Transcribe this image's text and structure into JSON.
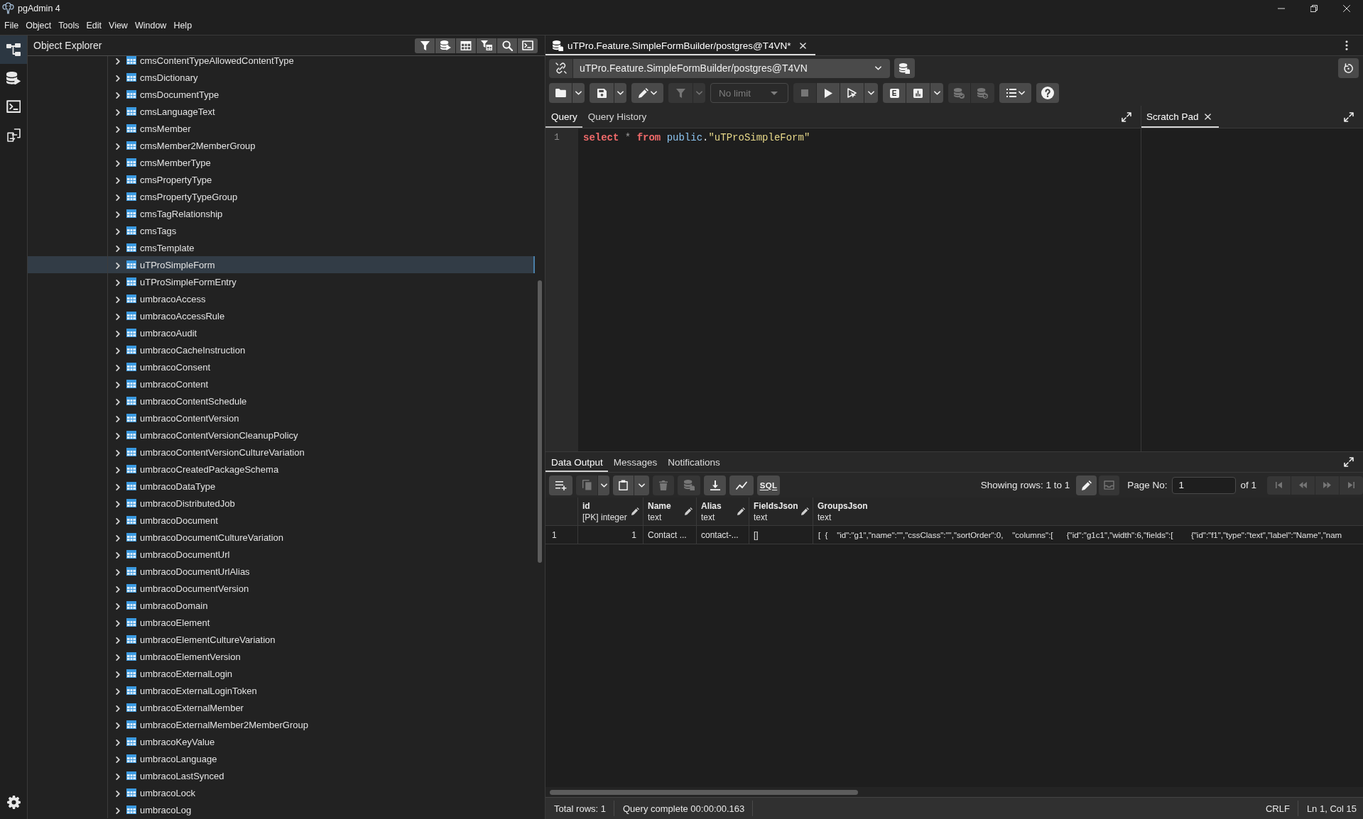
{
  "window": {
    "title": "pgAdmin 4"
  },
  "menu": [
    "File",
    "Object",
    "Tools",
    "Edit",
    "View",
    "Window",
    "Help"
  ],
  "rail": [
    {
      "selected": true
    },
    {
      "selected": false
    },
    {
      "selected": false
    },
    {
      "selected": false
    }
  ],
  "object_explorer": {
    "title": "Object Explorer",
    "tree": [
      {
        "label": "cmsContentTypeAllowedContentType",
        "selected": false,
        "expanded": false
      },
      {
        "label": "cmsDictionary",
        "selected": false,
        "expanded": false
      },
      {
        "label": "cmsDocumentType",
        "selected": false,
        "expanded": false
      },
      {
        "label": "cmsLanguageText",
        "selected": false,
        "expanded": false
      },
      {
        "label": "cmsMember",
        "selected": false,
        "expanded": false
      },
      {
        "label": "cmsMember2MemberGroup",
        "selected": false,
        "expanded": false
      },
      {
        "label": "cmsMemberType",
        "selected": false,
        "expanded": false
      },
      {
        "label": "cmsPropertyType",
        "selected": false,
        "expanded": false
      },
      {
        "label": "cmsPropertyTypeGroup",
        "selected": false,
        "expanded": false
      },
      {
        "label": "cmsTagRelationship",
        "selected": false,
        "expanded": false
      },
      {
        "label": "cmsTags",
        "selected": false,
        "expanded": false
      },
      {
        "label": "cmsTemplate",
        "selected": false,
        "expanded": false
      },
      {
        "label": "uTProSimpleForm",
        "selected": true,
        "expanded": false
      },
      {
        "label": "uTProSimpleFormEntry",
        "selected": false,
        "expanded": false
      },
      {
        "label": "umbracoAccess",
        "selected": false,
        "expanded": false
      },
      {
        "label": "umbracoAccessRule",
        "selected": false,
        "expanded": false
      },
      {
        "label": "umbracoAudit",
        "selected": false,
        "expanded": false
      },
      {
        "label": "umbracoCacheInstruction",
        "selected": false,
        "expanded": false
      },
      {
        "label": "umbracoConsent",
        "selected": false,
        "expanded": false
      },
      {
        "label": "umbracoContent",
        "selected": false,
        "expanded": false
      },
      {
        "label": "umbracoContentSchedule",
        "selected": false,
        "expanded": false
      },
      {
        "label": "umbracoContentVersion",
        "selected": false,
        "expanded": false
      },
      {
        "label": "umbracoContentVersionCleanupPolicy",
        "selected": false,
        "expanded": false
      },
      {
        "label": "umbracoContentVersionCultureVariation",
        "selected": false,
        "expanded": false
      },
      {
        "label": "umbracoCreatedPackageSchema",
        "selected": false,
        "expanded": false
      },
      {
        "label": "umbracoDataType",
        "selected": false,
        "expanded": false
      },
      {
        "label": "umbracoDistributedJob",
        "selected": false,
        "expanded": false
      },
      {
        "label": "umbracoDocument",
        "selected": false,
        "expanded": false
      },
      {
        "label": "umbracoDocumentCultureVariation",
        "selected": false,
        "expanded": false
      },
      {
        "label": "umbracoDocumentUrl",
        "selected": false,
        "expanded": false
      },
      {
        "label": "umbracoDocumentUrlAlias",
        "selected": false,
        "expanded": false
      },
      {
        "label": "umbracoDocumentVersion",
        "selected": false,
        "expanded": false
      },
      {
        "label": "umbracoDomain",
        "selected": false,
        "expanded": false
      },
      {
        "label": "umbracoElement",
        "selected": false,
        "expanded": false
      },
      {
        "label": "umbracoElementCultureVariation",
        "selected": false,
        "expanded": false
      },
      {
        "label": "umbracoElementVersion",
        "selected": false,
        "expanded": false
      },
      {
        "label": "umbracoExternalLogin",
        "selected": false,
        "expanded": false
      },
      {
        "label": "umbracoExternalLoginToken",
        "selected": false,
        "expanded": false
      },
      {
        "label": "umbracoExternalMember",
        "selected": false,
        "expanded": false
      },
      {
        "label": "umbracoExternalMember2MemberGroup",
        "selected": false,
        "expanded": false
      },
      {
        "label": "umbracoKeyValue",
        "selected": false,
        "expanded": false
      },
      {
        "label": "umbracoLanguage",
        "selected": false,
        "expanded": false
      },
      {
        "label": "umbracoLastSynced",
        "selected": false,
        "expanded": false
      },
      {
        "label": "umbracoLock",
        "selected": false,
        "expanded": false
      },
      {
        "label": "umbracoLog",
        "selected": false,
        "expanded": false
      }
    ]
  },
  "query_tabs": [
    {
      "label": "uTPro.Feature.SimpleFormBuilder/postgres@T4VN*",
      "selected": true
    }
  ],
  "connection": {
    "value": "uTPro.Feature.SimpleFormBuilder/postgres@T4VN"
  },
  "query_toolbar": [
    {
      "disabled": false
    },
    {
      "disabled": false
    },
    {
      "disabled": false
    },
    {
      "disabled": false
    },
    {
      "disabled": false
    },
    {
      "disabled": true
    },
    {
      "disabled": true
    },
    {
      "disabled": true
    },
    {
      "disabled": false
    },
    {
      "disabled": false
    },
    {
      "disabled": false
    },
    {
      "label": "E",
      "disabled": false
    },
    {
      "disabled": false
    },
    {
      "disabled": false
    },
    {
      "disabled": true
    },
    {
      "disabled": true
    },
    {
      "disabled": false
    },
    {
      "disabled": false
    }
  ],
  "limit": {
    "value": "No limit",
    "disabled": true
  },
  "editor_tabs": [
    {
      "label": "Query",
      "selected": true
    },
    {
      "label": "Query History",
      "selected": false
    }
  ],
  "editor": {
    "lines": [
      {
        "number": "1",
        "tokens": [
          {
            "kind": "keyword",
            "text": "select"
          },
          {
            "kind": "operator",
            "text": " * "
          },
          {
            "kind": "keyword",
            "text": "from"
          },
          {
            "kind": "identifier",
            "text": " public"
          },
          {
            "kind": "punct",
            "text": "."
          },
          {
            "kind": "string",
            "text": "\"uTProSimpleForm\""
          }
        ]
      }
    ]
  },
  "scratch_tabs": [
    {
      "label": "Scratch Pad",
      "selected": true
    }
  ],
  "results": {
    "tabs": [
      {
        "label": "Data Output",
        "selected": true
      },
      {
        "label": "Messages",
        "selected": false
      },
      {
        "label": "Notifications",
        "selected": false
      }
    ],
    "toolbar": [
      {
        "disabled": false
      },
      {
        "disabled": true
      },
      {
        "disabled": false
      },
      {
        "disabled": false
      },
      {
        "disabled": false
      },
      {
        "disabled": true
      },
      {
        "disabled": true
      },
      {
        "disabled": false
      },
      {
        "disabled": false
      },
      {
        "label": "SQL",
        "disabled": false
      }
    ],
    "showing": "Showing rows: 1 to 1",
    "view_tools": [
      {
        "disabled": false
      },
      {
        "disabled": true
      }
    ],
    "page_label": "Page No:",
    "page_value": "1",
    "page_total": "of 1",
    "nav": [
      {
        "disabled": true
      },
      {
        "disabled": true
      },
      {
        "disabled": true
      },
      {
        "disabled": true
      }
    ],
    "columns": [
      {
        "name": "id",
        "type": "[PK] integer"
      },
      {
        "name": "Name",
        "type": "text"
      },
      {
        "name": "Alias",
        "type": "text"
      },
      {
        "name": "FieldsJson",
        "type": "text"
      },
      {
        "name": "GroupsJson",
        "type": "text"
      }
    ],
    "rows": [
      {
        "number": "1",
        "cells": [
          "1",
          "Contact ...",
          "contact-...",
          "[]",
          "[  {    \"id\":\"g1\",\"name\":\"\",\"cssClass\":\"\",\"sortOrder\":0,    \"columns\":[      {\"id\":\"g1c1\",\"width\":6,\"fields\":[        {\"id\":\"f1\",\"type\":\"text\",\"label\":\"Name\",\"nam"
        ]
      }
    ]
  },
  "status_bar": {
    "total_rows": "Total rows: 1",
    "message": "Query complete 00:00:00.163",
    "line_ending": "CRLF",
    "cursor": "Ln 1, Col 15"
  }
}
